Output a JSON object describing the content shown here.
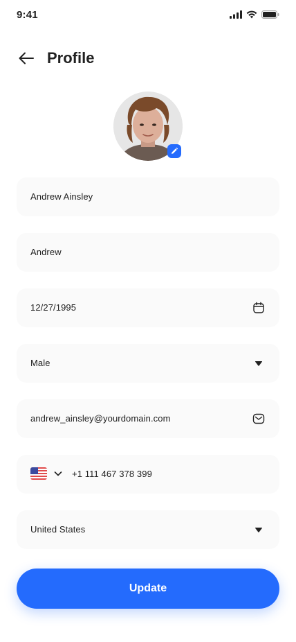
{
  "status_bar": {
    "time": "9:41"
  },
  "header": {
    "title": "Profile"
  },
  "avatar": {
    "edit": "edit-icon"
  },
  "form": {
    "full_name": "Andrew Ainsley",
    "nickname": "Andrew",
    "date_of_birth": "12/27/1995",
    "gender": "Male",
    "email": "andrew_ainsley@yourdomain.com",
    "phone": "+1 111 467 378 399",
    "country": "United States"
  },
  "icons": {
    "calendar": "calendar-icon",
    "dropdown": "triangle-down-icon",
    "email": "envelope-icon",
    "flag": "us-flag-icon"
  },
  "update_label": "Update",
  "colors": {
    "accent": "#246BFD",
    "field_bg": "#FAFAFA",
    "text": "#212121"
  }
}
